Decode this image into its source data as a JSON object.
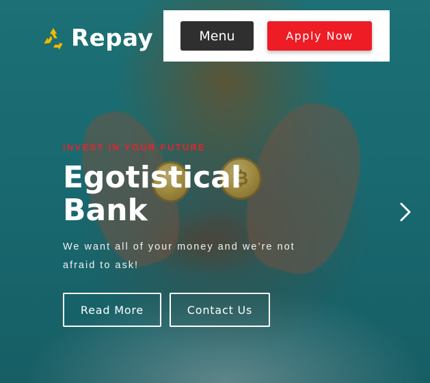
{
  "brand": {
    "name": "Repay",
    "logo_icon": "recycle-icon",
    "logo_color": "#f5b800"
  },
  "nav": {
    "menu_label": "Menu",
    "apply_label": "Apply Now",
    "menu_color": "#2f2f2f",
    "apply_color": "#ee1c25"
  },
  "hero": {
    "eyebrow": "INVEST IN YOUR FUTURE",
    "headline": "Egotistical Bank",
    "subtext": "We want all of your money and we’re not afraid to ask!",
    "accent_color": "#e3252c",
    "buttons": {
      "read_more": "Read More",
      "contact_us": "Contact Us"
    },
    "next_icon": "chevron-right-icon"
  }
}
